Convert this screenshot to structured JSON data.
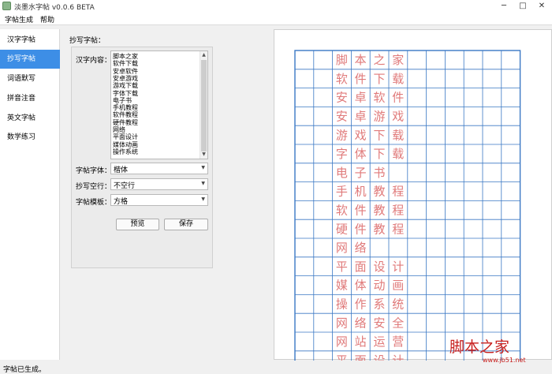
{
  "window": {
    "title": "淡墨水字帖 v0.0.6 BETA",
    "minimize": "─",
    "maximize": "□",
    "close": "✕"
  },
  "menu": [
    "字帖生成",
    "帮助"
  ],
  "sidebar": {
    "items": [
      {
        "label": "汉字字帖",
        "active": false
      },
      {
        "label": "抄写字帖",
        "active": true
      },
      {
        "label": "词语默写",
        "active": false
      },
      {
        "label": "拼音注音",
        "active": false
      },
      {
        "label": "英文字帖",
        "active": false
      },
      {
        "label": "数学练习",
        "active": false
      }
    ]
  },
  "panel": {
    "group_title": "抄写字帖：",
    "content_label": "汉字内容：",
    "content_lines": [
      "脚本之家",
      "软件下载",
      "安卓软件",
      "安卓游戏",
      "游戏下载",
      "字体下载",
      "电子书",
      "手机教程",
      "软件教程",
      "硬件教程",
      "网络",
      "平面设计",
      "媒体动画",
      "操作系统"
    ],
    "font_label": "字帖字体：",
    "font_value": "楷体",
    "blank_label": "抄写空行：",
    "blank_value": "不空行",
    "template_label": "字帖模板：",
    "template_value": "方格",
    "preview_button": "预览",
    "save_button": "保存"
  },
  "preview": {
    "rows": [
      "脚本之家",
      "软件下载",
      "安卓软件",
      "安卓游戏",
      "游戏下载",
      "字体下载",
      "电子书",
      "手机教程",
      "软件教程",
      "硬件教程",
      "网络",
      "平面设计",
      "媒体动画",
      "操作系统",
      "网络安全",
      "网站运营",
      "平面设计"
    ],
    "grid_color": "#3a78c4",
    "text_color": "#e07a7a"
  },
  "status": {
    "text": "字帖已生成。"
  },
  "watermark": {
    "text": "脚本之家",
    "url": "www.jb51.net"
  }
}
